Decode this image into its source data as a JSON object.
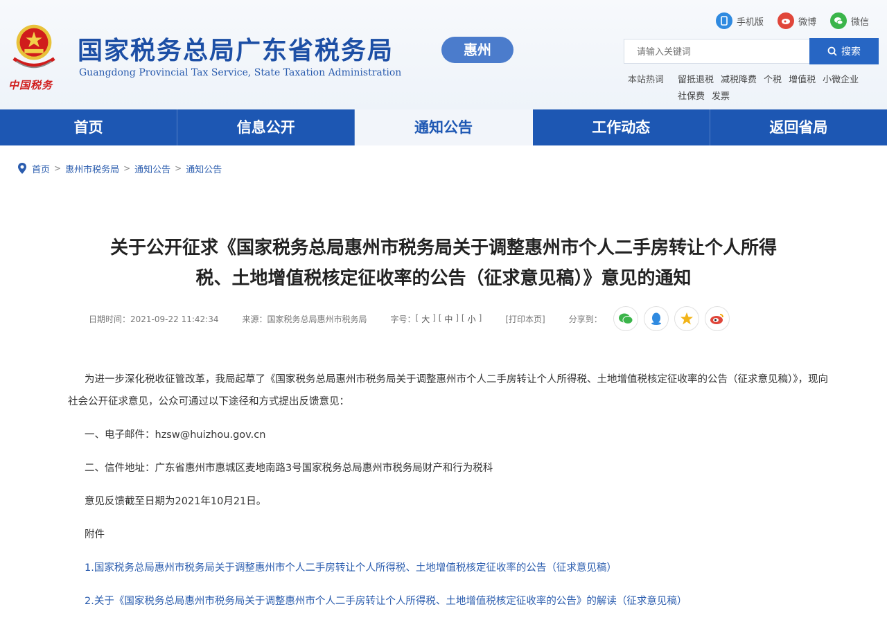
{
  "header": {
    "title": "国家税务总局广东省税务局",
    "subtitle": "Guangdong Provincial Tax Service, State Taxation Administration",
    "emblem_caption": "中国税务",
    "city": "惠州",
    "top_links": [
      {
        "label": "手机版",
        "icon": "mobile-icon",
        "color": "#2f8ae0"
      },
      {
        "label": "微博",
        "icon": "weibo-icon",
        "color": "#e0463a"
      },
      {
        "label": "微信",
        "icon": "wechat-icon",
        "color": "#3bb54a"
      }
    ],
    "search": {
      "placeholder": "请输入关键词",
      "button_label": "搜索"
    },
    "hot_search": {
      "label": "本站热词",
      "row1": [
        "留抵退税",
        "减税降费",
        "个税",
        "增值税",
        "小微企业"
      ],
      "row2": [
        "社保费",
        "发票"
      ]
    }
  },
  "nav": {
    "items": [
      "首页",
      "信息公开",
      "通知公告",
      "工作动态",
      "返回省局"
    ],
    "active_index": 2
  },
  "breadcrumb": [
    "首页",
    "惠州市税务局",
    "通知公告",
    "通知公告"
  ],
  "article": {
    "title_line1": "关于公开征求《国家税务总局惠州市税务局关于调整惠州市个人二手房转让个人所得",
    "title_line2": "税、土地增值税核定征收率的公告（征求意见稿）》意见的通知",
    "meta": {
      "time_label": "日期时间：",
      "time": "2021-09-22 11:42:34",
      "source_label": "来源：",
      "source": "国家税务总局惠州市税务局",
      "font_label": "字号：",
      "font_sizes": [
        "大",
        "中",
        "小"
      ],
      "print_label": "打印本页",
      "share_label": "分享到："
    },
    "share_icons": [
      {
        "name": "wechat",
        "color": "#3bb54a"
      },
      {
        "name": "qq",
        "color": "#2f8ae0"
      },
      {
        "name": "qzone",
        "color": "#f2b418"
      },
      {
        "name": "weibo",
        "color": "#e0463a"
      }
    ],
    "para1": "为进一步深化税收征管改革，我局起草了《国家税务总局惠州市税务局关于调整惠州市个人二手房转让个人所得税、土地增值税核定征收率的公告（征求意见稿）》，现向社会公开征求意见，公众可通过以下途径和方式提出反馈意见：",
    "item1": "一、电子邮件：hzsw@huizhou.gov.cn",
    "item2": "二、信件地址：广东省惠州市惠城区麦地南路3号国家税务总局惠州市税务局财产和行为税科",
    "deadline": "意见反馈截至日期为2021年10月21日。",
    "attach_label": "附件",
    "attachments": [
      "1.国家税务总局惠州市税务局关于调整惠州市个人二手房转让个人所得税、土地增值税核定征收率的公告（征求意见稿）",
      "2.关于《国家税务总局惠州市税务局关于调整惠州市个人二手房转让个人所得税、土地增值税核定征收率的公告》的解读（征求意见稿）"
    ]
  },
  "colors": {
    "brand_blue": "#1d57b3",
    "title_blue": "#1d4fa5",
    "emblem_red": "#d01c1c"
  }
}
